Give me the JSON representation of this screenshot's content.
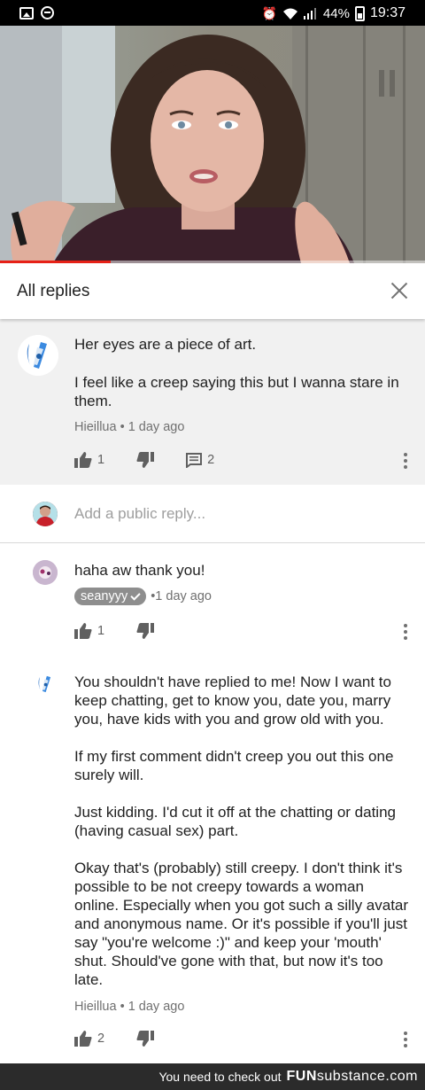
{
  "status_bar": {
    "battery": "44%",
    "time": "19:37"
  },
  "video": {
    "progress_fraction": 0.26
  },
  "header": {
    "title": "All replies"
  },
  "parent_comment": {
    "paragraphs": [
      "Her eyes are a piece of art.",
      "I feel like a creep saying this but I wanna stare in them."
    ],
    "author": "Hieillua",
    "age": "1 day ago",
    "likes": "1",
    "replies": "2"
  },
  "add_reply": {
    "placeholder": "Add a public reply..."
  },
  "replies": [
    {
      "text": "haha aw thank you!",
      "author": "seanyyy",
      "age": "1 day ago",
      "likes": "1"
    },
    {
      "paragraphs": [
        "You shouldn't have replied to me! Now I want to keep chatting, get to know you, date you, marry you, have kids with you and grow old with you.",
        "If my first comment didn't creep you out this one surely will.",
        "Just kidding. I'd cut it off at the chatting or dating (having casual sex) part.",
        "Okay that's (probably) still creepy. I don't think it's possible to be not creepy towards a woman online. Especially when you got such a silly avatar and anonymous name. Or it's possible if you'll just say \"you're welcome :)\" and keep your 'mouth' shut. Should've gone with that, but now it's too late."
      ],
      "author": "Hieillua",
      "age": "1 day ago",
      "likes": "2"
    }
  ],
  "banner": {
    "text": "You need to check out",
    "brand_a": "FUN",
    "brand_b": "substance",
    "brand_c": ".com"
  },
  "colors": {
    "accent_red": "#e62117",
    "parent_bg": "#f1f1f1",
    "meta_gray": "#707070"
  }
}
